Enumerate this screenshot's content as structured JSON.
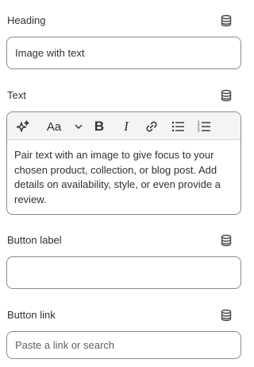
{
  "heading": {
    "label": "Heading",
    "value": "Image with text"
  },
  "text": {
    "label": "Text",
    "toolbar": {
      "font_label": "Aa"
    },
    "body": "Pair text with an image to give focus to your chosen product, collection, or blog post. Add details on availability, style, or even provide a review."
  },
  "button_label": {
    "label": "Button label",
    "value": ""
  },
  "button_link": {
    "label": "Button link",
    "placeholder": "Paste a link or search"
  },
  "icons": {
    "dynamic_source": "database-icon",
    "magic": "sparkle-icon",
    "font": "font-style-icon",
    "dropdown": "chevron-down-icon",
    "bold": "bold-icon",
    "italic": "italic-icon",
    "link": "link-icon",
    "bullet_list": "bullet-list-icon",
    "numbered_list": "numbered-list-icon"
  },
  "colors": {
    "border": "#8a8a8a",
    "toolbar_bg": "#f4f4f4",
    "text": "#303030",
    "placeholder": "#616161"
  }
}
